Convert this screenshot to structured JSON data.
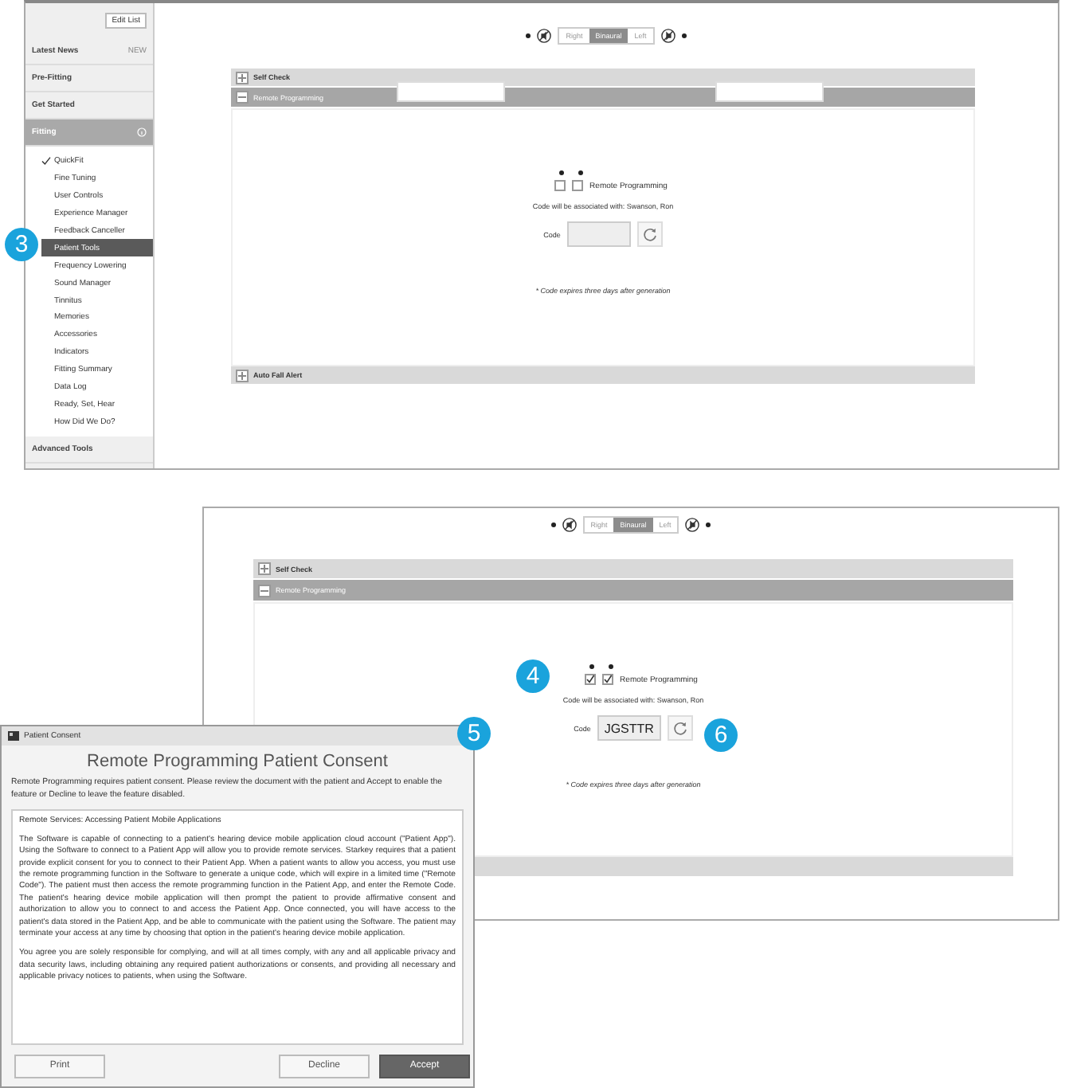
{
  "screens": [
    {
      "sidebar": {
        "edit_button": "Edit List",
        "items": [
          {
            "label": "Latest News",
            "badge": "NEW"
          },
          {
            "label": "Pre-Fitting"
          },
          {
            "label": "Get Started"
          },
          {
            "label": "Fitting",
            "expanded": true,
            "children": [
              {
                "label": "QuickFit",
                "checked": true,
                "selected": false
              },
              {
                "label": "Fine Tuning",
                "checked": false,
                "selected": false
              },
              {
                "label": "User Controls",
                "checked": false,
                "selected": false
              },
              {
                "label": "Experience Manager",
                "checked": false,
                "selected": false
              },
              {
                "label": "Feedback Canceller",
                "checked": false,
                "selected": false
              },
              {
                "label": "Patient Tools",
                "checked": false,
                "selected": true
              },
              {
                "label": "Frequency Lowering",
                "checked": false,
                "selected": false
              },
              {
                "label": "Sound Manager",
                "checked": false,
                "selected": false
              },
              {
                "label": "Tinnitus",
                "checked": false,
                "selected": false
              },
              {
                "label": "Memories",
                "checked": false,
                "selected": false
              },
              {
                "label": "Accessories",
                "checked": false,
                "selected": false
              },
              {
                "label": "Indicators",
                "checked": false,
                "selected": false
              },
              {
                "label": "Fitting Summary",
                "checked": false,
                "selected": false
              },
              {
                "label": "Data Log",
                "checked": false,
                "selected": false
              },
              {
                "label": "Ready, Set, Hear",
                "checked": false,
                "selected": false
              },
              {
                "label": "How Did We Do?",
                "checked": false,
                "selected": false
              }
            ]
          },
          {
            "label": "Advanced Tools"
          }
        ]
      },
      "toolbar": {
        "sides": [
          {
            "label": "Right",
            "selected": false
          },
          {
            "label": "Binaural",
            "selected": true
          },
          {
            "label": "Left",
            "selected": false
          }
        ]
      },
      "sections": [
        {
          "title": "Self Check",
          "expanded": false
        },
        {
          "title": "Remote Programming",
          "expanded": true,
          "content": {
            "checkboxes": [
              {
                "checked": false
              },
              {
                "checked": false
              }
            ],
            "label": "Remote Programming",
            "association": "Code will be associated with: Swanson, Ron",
            "code_label": "Code",
            "note": "* Code expires three days after generation"
          }
        },
        {
          "title": "Auto Fall Alert",
          "expanded": false
        }
      ]
    },
    {
      "toolbar": {
        "sides": [
          {
            "label": "Right",
            "selected": false
          },
          {
            "label": "Binaural",
            "selected": true
          },
          {
            "label": "Left",
            "selected": false
          }
        ]
      },
      "sections": [
        {
          "title": "Self Check",
          "expanded": false
        },
        {
          "title": "Remote Programming",
          "expanded": true,
          "content": {
            "checkboxes": [
              {
                "checked": true
              },
              {
                "checked": true
              }
            ],
            "label": "Remote Programming",
            "association": "Code will be associated with: Swanson, Ron",
            "code_label": "Code",
            "code_value": "JGSTTR",
            "note": "* Code expires three days after generation"
          }
        },
        {
          "expanded": false
        }
      ]
    }
  ],
  "dialog": {
    "title": "Patient Consent",
    "heading": "Remote Programming Patient Consent",
    "intro": "Remote Programming requires patient consent.  Please review the document with the patient and Accept to enable the feature or Decline to leave the feature disabled.",
    "document": {
      "title": "Remote Services: Accessing Patient Mobile Applications",
      "paragraphs": [
        "The Software is capable of connecting to a patient's hearing device mobile application cloud account (\"Patient App\").  Using the Software to connect to a Patient App will allow you to provide remote services. Starkey requires that a patient provide explicit consent for you to connect to their Patient App.  When a patient wants to allow you access, you must use the remote programming function in the Software to generate a unique code, which will expire in a limited time (\"Remote Code\").  The patient must then access the remote programming function in the Patient App, and enter the Remote Code.  The patient's hearing device mobile application will then prompt the patient to provide affirmative consent and authorization to allow you to connect to and access the Patient App.  Once connected, you will have access to the patient's data stored in the Patient App, and be able to communicate with the patient using the Software.  The patient may terminate your access at any time by choosing that option in the patient's hearing device mobile application.",
        "You agree you are solely responsible for complying, and will at all times comply, with any and all applicable privacy and data security laws, including obtaining any required patient authorizations or consents, and providing all necessary and applicable privacy notices to patients, when using the Software."
      ]
    },
    "buttons": [
      {
        "label": "Print",
        "kind": "secondary"
      },
      {
        "label": "Decline",
        "kind": "secondary"
      },
      {
        "label": "Accept",
        "kind": "primary"
      }
    ]
  },
  "callouts": [
    {
      "number": "3"
    },
    {
      "number": "4"
    },
    {
      "number": "5"
    },
    {
      "number": "6"
    }
  ]
}
